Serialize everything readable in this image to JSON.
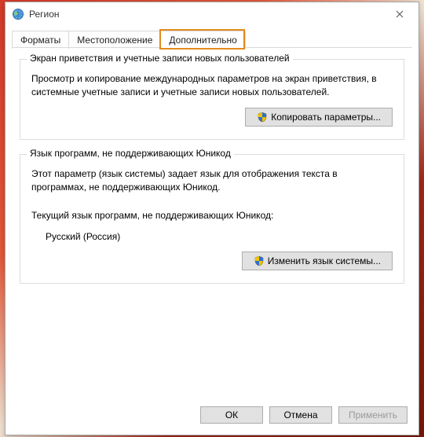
{
  "window": {
    "title": "Регион"
  },
  "tabs": {
    "formats": "Форматы",
    "location": "Местоположение",
    "advanced": "Дополнительно"
  },
  "group1": {
    "title": "Экран приветствия и учетные записи новых пользователей",
    "desc": "Просмотр и копирование международных параметров на экран приветствия, в системные учетные записи и учетные записи новых пользователей.",
    "button": "Копировать параметры..."
  },
  "group2": {
    "title": "Язык программ, не поддерживающих Юникод",
    "desc": "Этот параметр (язык системы) задает язык для отображения текста в программах, не поддерживающих Юникод.",
    "current_label": "Текущий язык программ, не поддерживающих Юникод:",
    "current_value": "Русский (Россия)",
    "button": "Изменить язык системы..."
  },
  "footer": {
    "ok": "ОК",
    "cancel": "Отмена",
    "apply": "Применить"
  }
}
